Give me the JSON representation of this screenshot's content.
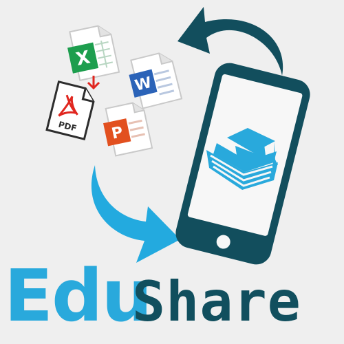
{
  "logo": {
    "part_edu": "Edu",
    "part_share": "Share",
    "colors": {
      "edu": "#29a9dc",
      "share": "#114f5e",
      "phone": "#124e5d",
      "screen": "#f7f7f7",
      "arrow_dark": "#124e5d",
      "arrow_light": "#23aadf",
      "book_cap": "#29a9dc"
    }
  },
  "file_icons": [
    {
      "name": "excel-icon",
      "letter": "X",
      "color": "#1d9e4e"
    },
    {
      "name": "word-icon",
      "letter": "W",
      "color": "#2b63b8"
    },
    {
      "name": "pdf-icon",
      "letter": "PDF",
      "color": "#e0261f"
    },
    {
      "name": "powerpoint-icon",
      "letter": "P",
      "color": "#e2501f"
    }
  ]
}
